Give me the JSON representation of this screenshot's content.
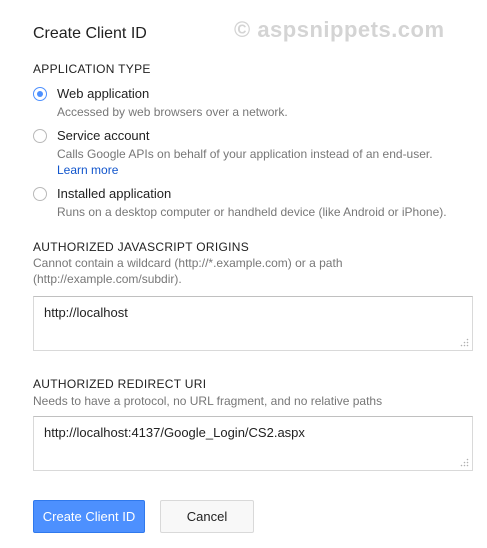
{
  "dialog": {
    "title": "Create Client ID",
    "watermark": "© aspsnippets.com"
  },
  "application_type": {
    "heading": "APPLICATION TYPE",
    "options": [
      {
        "label": "Web application",
        "description": "Accessed by web browsers over a network.",
        "selected": true
      },
      {
        "label": "Service account",
        "description": "Calls Google APIs on behalf of your application instead of an end-user.",
        "link": "Learn more",
        "selected": false
      },
      {
        "label": "Installed application",
        "description": "Runs on a desktop computer or handheld device (like Android or iPhone).",
        "selected": false
      }
    ]
  },
  "js_origins": {
    "heading": "AUTHORIZED JAVASCRIPT ORIGINS",
    "help_line1": "Cannot contain a wildcard (http://*.example.com) or a path",
    "help_line2": "(http://example.com/subdir).",
    "value": "http://localhost"
  },
  "redirect_uri": {
    "heading": "AUTHORIZED REDIRECT URI",
    "help": "Needs to have a protocol, no URL fragment, and no relative paths",
    "value": "http://localhost:4137/Google_Login/CS2.aspx"
  },
  "actions": {
    "create_label": "Create Client ID",
    "cancel_label": "Cancel"
  },
  "colors": {
    "accent": "#4d90fe",
    "link": "#1155cc",
    "muted_text": "#777777"
  }
}
